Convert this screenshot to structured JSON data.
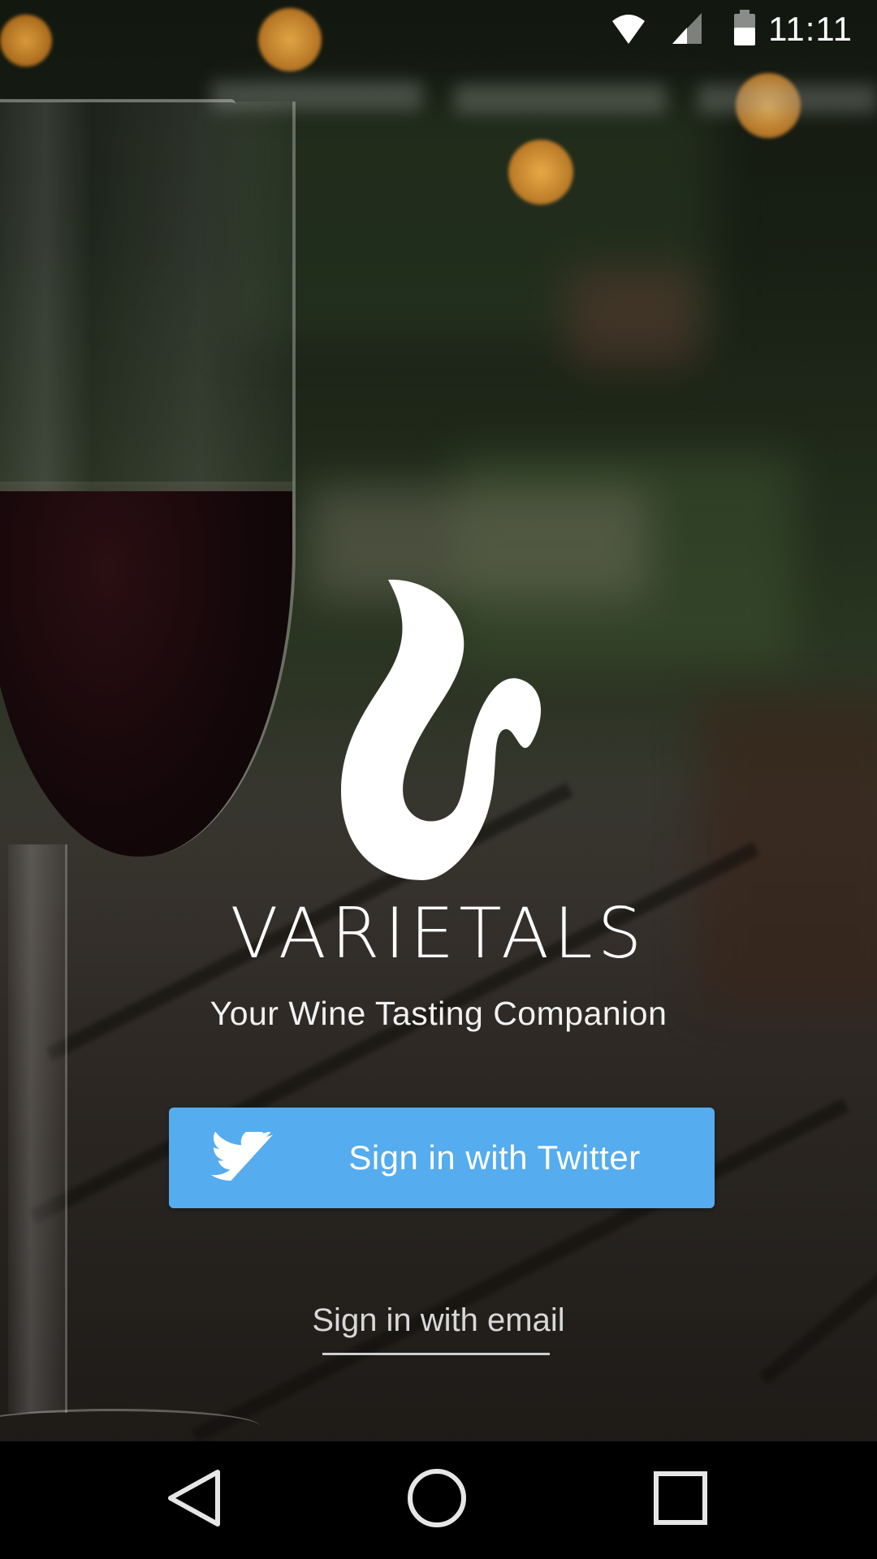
{
  "status_bar": {
    "time": "11:11",
    "icons": [
      "wifi-icon",
      "cell-signal-icon",
      "battery-icon"
    ]
  },
  "app": {
    "logo_icon": "varietals-wine-drop-logo-icon",
    "title": "VARIETALS",
    "tagline": "Your Wine Tasting Companion"
  },
  "actions": {
    "twitter_button": {
      "label": "Sign in with Twitter",
      "icon": "twitter-bird-icon",
      "color": "#55acee"
    },
    "email_link": {
      "label": "Sign in with email"
    }
  },
  "nav_bar": {
    "buttons": [
      "back-icon",
      "home-icon",
      "recents-icon"
    ]
  }
}
